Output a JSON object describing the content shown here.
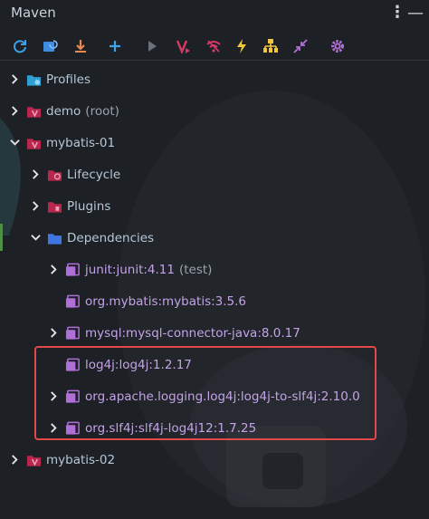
{
  "window": {
    "title": "Maven"
  },
  "toolbar": {
    "icons": [
      "reload-all-icon",
      "reimport-icon",
      "download-sources-icon",
      "add-maven-project-icon",
      "run-goal-icon",
      "execute-maven-goal-icon",
      "toggle-offline-mode-icon",
      "skip-tests-icon",
      "show-dependencies-icon",
      "collapse-all-icon",
      "settings-icon"
    ]
  },
  "tree": {
    "profiles": "Profiles",
    "demo": {
      "name": "demo",
      "suffix": "(root)"
    },
    "mybatis01": "mybatis-01",
    "lifecycle": "Lifecycle",
    "plugins": "Plugins",
    "dependencies": "Dependencies",
    "deps": [
      {
        "name": "junit:junit:4.11",
        "suffix": "(test)"
      },
      {
        "name": "org.mybatis:mybatis:3.5.6"
      },
      {
        "name": "mysql:mysql-connector-java:8.0.17"
      },
      {
        "name": "log4j:log4j:1.2.17"
      },
      {
        "name": "org.apache.logging.log4j:log4j-to-slf4j:2.10.0"
      },
      {
        "name": "org.slf4j:slf4j-log4j12:1.7.25"
      }
    ],
    "mybatis02": "mybatis-02"
  },
  "colors": {
    "accent": "#3f8de0",
    "maven": "#c7305a",
    "dependency": "#b06fd6",
    "highlight": "#e34848"
  }
}
